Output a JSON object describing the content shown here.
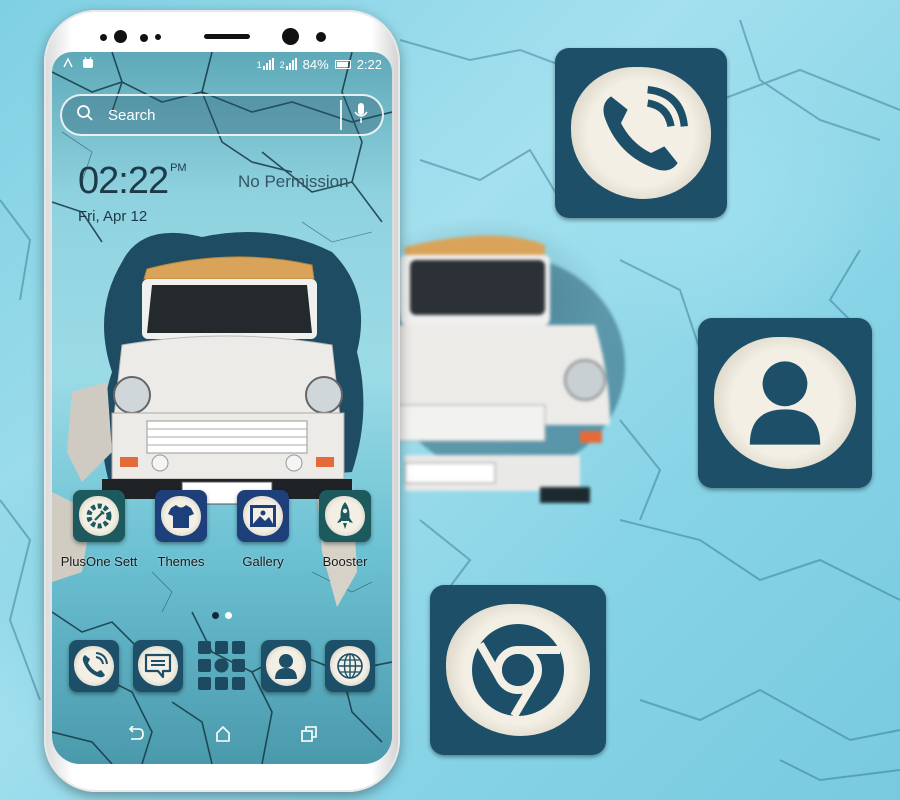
{
  "status_bar": {
    "signal_1_label": "1",
    "signal_2_label": "2",
    "battery_percent": "84%",
    "time": "2:22"
  },
  "search": {
    "placeholder": "Search"
  },
  "clock_widget": {
    "time": "02:22",
    "ampm": "PM",
    "date": "Fri, Apr 12",
    "weather_status": "No Permission"
  },
  "apps": [
    {
      "label": "PlusOne Sett",
      "icon": "gear-wrench-icon"
    },
    {
      "label": "Themes",
      "icon": "tshirt-icon"
    },
    {
      "label": "Gallery",
      "icon": "image-icon"
    },
    {
      "label": "Booster",
      "icon": "rocket-icon"
    }
  ],
  "dock": [
    {
      "name": "phone",
      "icon": "phone-icon"
    },
    {
      "name": "messages",
      "icon": "message-icon"
    },
    {
      "name": "app-drawer",
      "icon": "app-drawer-icon"
    },
    {
      "name": "contacts",
      "icon": "contact-icon"
    },
    {
      "name": "browser",
      "icon": "globe-icon"
    }
  ],
  "page_indicator": {
    "pages": 2,
    "current": 1
  },
  "navigation": [
    {
      "name": "back",
      "icon": "back-icon"
    },
    {
      "name": "home",
      "icon": "home-icon"
    },
    {
      "name": "recents",
      "icon": "recents-icon"
    }
  ],
  "featured_icons": [
    {
      "name": "phone",
      "icon": "phone-icon"
    },
    {
      "name": "contacts",
      "icon": "contact-icon"
    },
    {
      "name": "chrome",
      "icon": "chrome-icon"
    }
  ],
  "colors": {
    "icon_frame": "#1d5068",
    "icon_paper": "#f3efe4",
    "wall_blue": "#8fd6e6",
    "crack": "#1d3a48"
  }
}
